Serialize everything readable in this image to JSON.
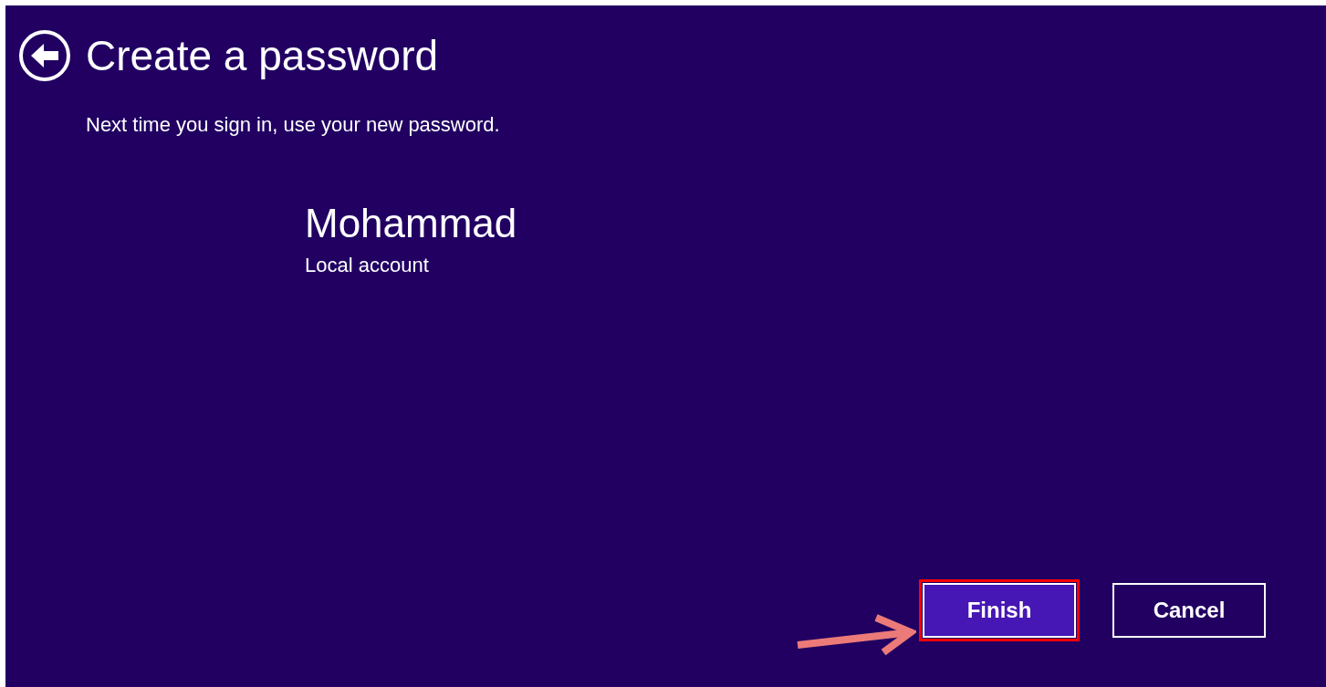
{
  "page": {
    "title": "Create a password",
    "subtitle": "Next time you sign in, use your new password."
  },
  "account": {
    "name": "Mohammad",
    "type": "Local account"
  },
  "buttons": [
    {
      "label": "Finish",
      "kind": "primary",
      "highlighted": true
    },
    {
      "label": "Cancel",
      "kind": "secondary",
      "highlighted": false
    }
  ]
}
